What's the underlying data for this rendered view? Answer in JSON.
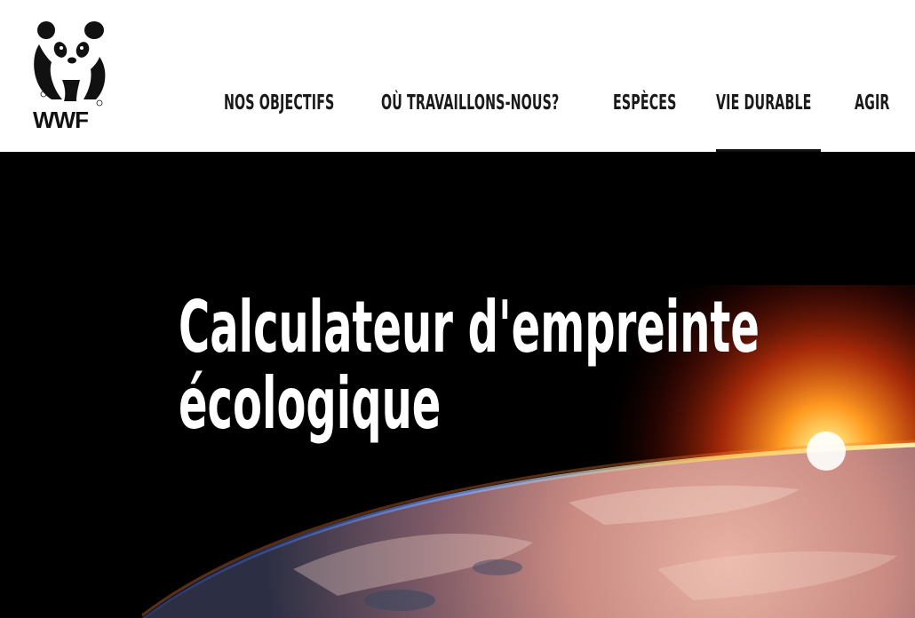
{
  "brand": {
    "name": "WWF"
  },
  "nav": {
    "items": [
      {
        "label": "NOS OBJECTIFS",
        "active": false
      },
      {
        "label": "OÙ TRAVAILLONS-NOUS?",
        "active": false
      },
      {
        "label": "ESPÈCES",
        "active": false
      },
      {
        "label": "VIE DURABLE",
        "active": true
      },
      {
        "label": "AGIR",
        "active": false
      }
    ]
  },
  "hero": {
    "title_line1": "Calculateur d'empreinte",
    "title_line2": "écologique",
    "image": "earth-horizon-sunrise"
  },
  "colors": {
    "header_bg": "#ffffff",
    "nav_text": "#1a1a1a",
    "hero_bg": "#000000",
    "hero_text": "#ffffff",
    "sun_glow": "#ffb020"
  }
}
